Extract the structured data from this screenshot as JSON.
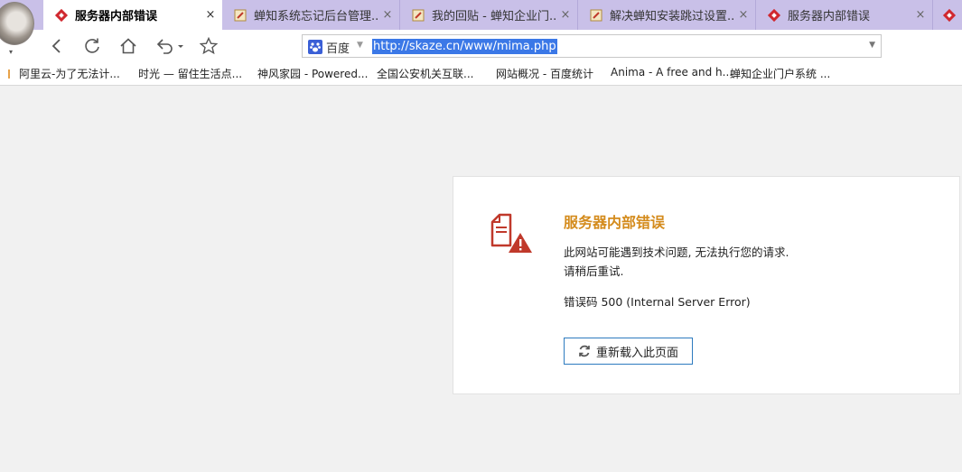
{
  "browser": {
    "tabs": [
      {
        "title": "服务器内部错误",
        "active": true,
        "icon": "error-favicon"
      },
      {
        "title": "蝉知系统忘记后台管理...",
        "active": false,
        "icon": "page-edit-favicon"
      },
      {
        "title": "我的回贴 - 蝉知企业门...",
        "active": false,
        "icon": "page-edit-favicon"
      },
      {
        "title": "解决蝉知安装跳过设置...",
        "active": false,
        "icon": "page-edit-favicon"
      },
      {
        "title": "服务器内部错误",
        "active": false,
        "icon": "error-favicon"
      }
    ],
    "close_glyph": "×",
    "address_bar": {
      "search_engine": "百度",
      "url": "http://skaze.cn/www/mima.php"
    },
    "bookmarks": [
      "阿里云-为了无法计...",
      "时光 — 留住生活点...",
      "神风家园 - Powered...",
      "全国公安机关互联...",
      "网站概况 - 百度统计",
      "Anima - A free and h...",
      "蝉知企业门户系统 ..."
    ]
  },
  "error_page": {
    "title": "服务器内部错误",
    "line1": "此网站可能遇到技术问题, 无法执行您的请求.",
    "line2": "请稍后重试.",
    "error_code": "错误码 500 (Internal Server Error)",
    "reload_label": "重新载入此页面"
  },
  "colors": {
    "tabbar": "#c9c0e8",
    "title_accent": "#d48b1c",
    "icon_red": "#c0392b",
    "button_border": "#2d7bbf"
  }
}
